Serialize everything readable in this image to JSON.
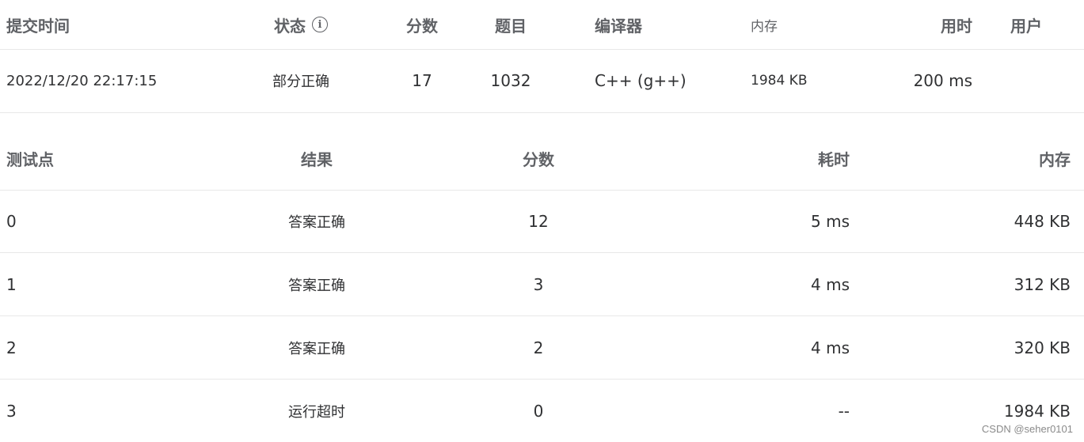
{
  "submission": {
    "headers": {
      "time": "提交时间",
      "status": "状态",
      "status_icon": "info-icon",
      "score": "分数",
      "problem": "题目",
      "compiler": "编译器",
      "memory": "内存",
      "time_used": "用时",
      "user": "用户"
    },
    "row": {
      "time": "2022/12/20 22:17:15",
      "status": "部分正确",
      "score": "17",
      "problem": "1032",
      "compiler": "C++ (g++)",
      "memory": "1984 KB",
      "time_used": "200 ms",
      "user": ""
    }
  },
  "testcases": {
    "headers": {
      "id": "测试点",
      "result": "结果",
      "score": "分数",
      "time_used": "耗时",
      "memory": "内存"
    },
    "rows": [
      {
        "id": "0",
        "result": "答案正确",
        "score": "12",
        "time_used": "5 ms",
        "memory": "448 KB"
      },
      {
        "id": "1",
        "result": "答案正确",
        "score": "3",
        "time_used": "4 ms",
        "memory": "312 KB"
      },
      {
        "id": "2",
        "result": "答案正确",
        "score": "2",
        "time_used": "4 ms",
        "memory": "320 KB"
      },
      {
        "id": "3",
        "result": "运行超时",
        "score": "0",
        "time_used": "--",
        "memory": "1984 KB"
      }
    ]
  },
  "colors": {
    "partial": "#17a31d",
    "accepted": "#e8413b",
    "timeout": "#17a31d",
    "link": "#1e7ce6"
  },
  "watermark": "CSDN @seher0101"
}
